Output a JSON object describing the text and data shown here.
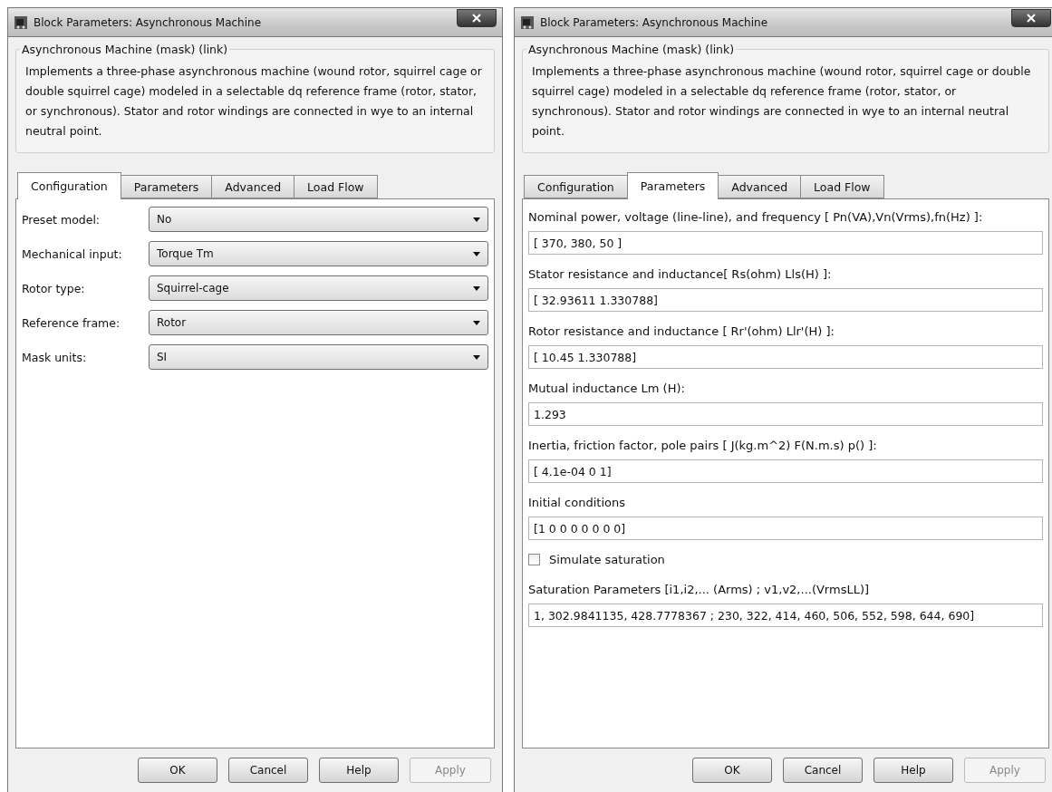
{
  "windows": [
    {
      "title": "Block Parameters: Asynchronous Machine",
      "group_title": "Asynchronous Machine (mask) (link)",
      "description": "Implements a three-phase asynchronous machine (wound rotor, squirrel cage or double squirrel cage) modeled in a selectable dq reference frame (rotor, stator, or synchronous). Stator and rotor windings are connected in wye to an internal neutral point.",
      "tabs": [
        {
          "label": "Configuration",
          "selected": true
        },
        {
          "label": "Parameters",
          "selected": false
        },
        {
          "label": "Advanced",
          "selected": false
        },
        {
          "label": "Load Flow",
          "selected": false
        }
      ],
      "content": {
        "kind": "configuration",
        "rows": [
          {
            "label": "Preset model:",
            "value": "No"
          },
          {
            "label": "Mechanical input:",
            "value": "Torque Tm"
          },
          {
            "label": "Rotor type:",
            "value": "Squirrel-cage"
          },
          {
            "label": "Reference frame:",
            "value": "Rotor"
          },
          {
            "label": "Mask units:",
            "value": "SI"
          }
        ]
      },
      "buttons": [
        {
          "label": "OK",
          "disabled": false
        },
        {
          "label": "Cancel",
          "disabled": false
        },
        {
          "label": "Help",
          "disabled": false
        },
        {
          "label": "Apply",
          "disabled": true
        }
      ]
    },
    {
      "title": "Block Parameters: Asynchronous Machine",
      "group_title": "Asynchronous Machine (mask) (link)",
      "description": "Implements a three-phase asynchronous machine (wound rotor, squirrel cage or double squirrel cage) modeled in a selectable dq reference frame (rotor, stator, or synchronous). Stator and rotor windings are connected in wye to an internal neutral point.",
      "tabs": [
        {
          "label": "Configuration",
          "selected": false
        },
        {
          "label": "Parameters",
          "selected": true
        },
        {
          "label": "Advanced",
          "selected": false
        },
        {
          "label": "Load Flow",
          "selected": false
        }
      ],
      "content": {
        "kind": "parameters",
        "items": [
          {
            "kind": "field",
            "label": "Nominal power, voltage (line-line), and frequency [ Pn(VA),Vn(Vrms),fn(Hz) ]:",
            "value": "[ 370, 380, 50 ]"
          },
          {
            "kind": "field",
            "label": "Stator resistance and inductance[ Rs(ohm)  Lls(H) ]:",
            "value": "[ 32.93611 1.330788]"
          },
          {
            "kind": "field",
            "label": "Rotor resistance and inductance [ Rr'(ohm)  Llr'(H) ]:",
            "value": "[ 10.45 1.330788]"
          },
          {
            "kind": "field",
            "label": "Mutual inductance Lm (H):",
            "value": "1.293"
          },
          {
            "kind": "field",
            "label": "Inertia, friction factor, pole pairs [ J(kg.m^2)  F(N.m.s)   p() ]:",
            "value": "[ 4.1e-04 0  1]"
          },
          {
            "kind": "field",
            "label": "Initial conditions",
            "value": "[1 0 0 0 0 0 0 0]"
          },
          {
            "kind": "checkbox",
            "label": "Simulate saturation",
            "checked": false
          },
          {
            "kind": "field",
            "label": "Saturation Parameters [i1,i2,... (Arms) ; v1,v2,...(VrmsLL)]",
            "value": "1, 302.9841135, 428.7778367 ; 230, 322, 414, 460, 506, 552, 598, 644, 690]"
          }
        ]
      },
      "buttons": [
        {
          "label": "OK",
          "disabled": false
        },
        {
          "label": "Cancel",
          "disabled": false
        },
        {
          "label": "Help",
          "disabled": false
        },
        {
          "label": "Apply",
          "disabled": true
        }
      ]
    }
  ]
}
